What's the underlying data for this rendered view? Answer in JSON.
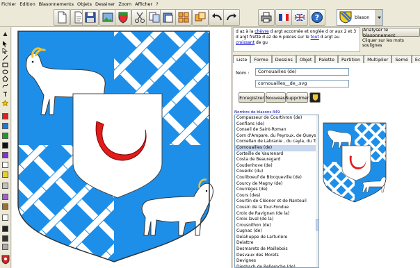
{
  "menu": [
    "Fichier",
    "Edition",
    "Blasonnements",
    "Objets",
    "Dessiner",
    "Zoom",
    "Afficher",
    "?"
  ],
  "toolbar": {
    "blason_label": "blason"
  },
  "description": {
    "parts": [
      {
        "t": "d az à la ",
        "u": false
      },
      {
        "t": "chèvre",
        "u": true
      },
      {
        "t": " d argt accornée et onglée d or aux 2 et 3 d argt fretté d az de 6 pièces sur le ",
        "u": false
      },
      {
        "t": "tout",
        "u": true
      },
      {
        "t": " d argt au ",
        "u": false
      },
      {
        "t": "croissant",
        "u": true
      },
      {
        "t": " de gu",
        "u": false
      }
    ]
  },
  "analyser_button": "Analyser le blasonnement",
  "analyser_hint": "Cliquer sur les mots soulignes",
  "tabs": [
    "Liste",
    "Forme",
    "Dessins",
    "Objet",
    "Palette",
    "Partition",
    "Multiplier",
    "Semé",
    "Ecartelé"
  ],
  "form": {
    "nom_label": "Nom :",
    "nom_value": "Cornouailles (de)",
    "file_value": "cornouailles__de_.svg"
  },
  "buttons": {
    "enregistrer": "Enregistrer",
    "nouveau": "Nouveau",
    "supprimer": "Supprimer"
  },
  "blason_count": "Nombre de blasons:349",
  "blasons": [
    "Compasseur de Courtivron (de)",
    "Conflans (de)",
    "Conseil de Saint-Roman",
    "Corn d'Ampare, du Peyroux, de Queyssac",
    "Cornellan de Labranie , du cayla, du Trave",
    "Cornouailles (de)",
    "Corteille de Vaurenard",
    "Costa de Beauregard",
    "Coudenhove (de)",
    "Couédic (du)",
    "Couliboeuf de Blocqueville (de)",
    "Courcy de Magny (de)",
    "Courrèges (de)",
    "Cours (des)",
    "Courtin de Cléonor et de Nanteuil",
    "Cousin de la Tour-Fondue",
    "Croix de Ravignan (de la)",
    "Croix-laval (de la)",
    "Crousnilhon (de)",
    "Cugnac (de)",
    "Delahuppe de Larturière",
    "Delattre",
    "Desmarets de Maillebois",
    "Desvaux des Morets",
    "Devignes",
    "Diesbach de Belleroche (de)"
  ],
  "selected_index": 5,
  "colors": {
    "azure": "#1e8fe8",
    "argent": "#ffffff",
    "gules": "#e21b1b",
    "gold": "#e8c43c",
    "select_bg": "#c6d7ef"
  }
}
